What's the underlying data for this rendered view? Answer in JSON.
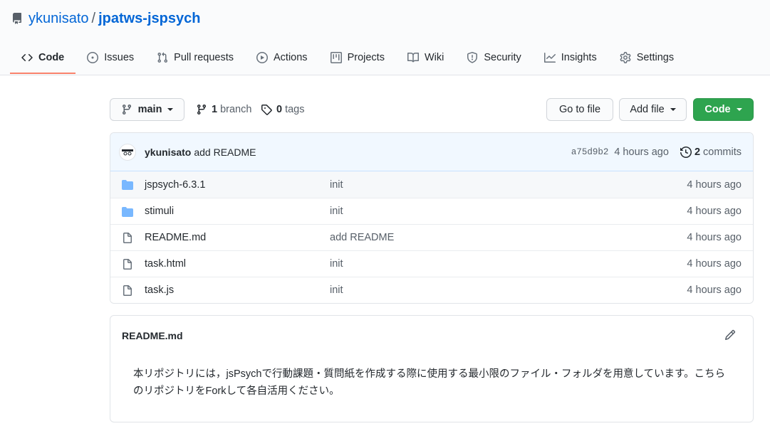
{
  "repo": {
    "owner": "ykunisato",
    "separator": "/",
    "name": "jpatws-jspsych"
  },
  "tabs": [
    {
      "label": "Code",
      "icon": "code-icon",
      "selected": true
    },
    {
      "label": "Issues",
      "icon": "issue-opened-icon"
    },
    {
      "label": "Pull requests",
      "icon": "git-pull-request-icon"
    },
    {
      "label": "Actions",
      "icon": "play-icon"
    },
    {
      "label": "Projects",
      "icon": "project-icon"
    },
    {
      "label": "Wiki",
      "icon": "book-icon"
    },
    {
      "label": "Security",
      "icon": "shield-icon"
    },
    {
      "label": "Insights",
      "icon": "graph-icon"
    },
    {
      "label": "Settings",
      "icon": "gear-icon"
    }
  ],
  "toolbar": {
    "branch_label": "main",
    "branches_count": "1",
    "branches_label": "branch",
    "tags_count": "0",
    "tags_label": "tags",
    "goto_label": "Go to file",
    "addfile_label": "Add file",
    "code_label": "Code"
  },
  "commit": {
    "author": "ykunisato",
    "message": "add README",
    "sha": "a75d9b2",
    "time": "4 hours ago",
    "commits_count": "2",
    "commits_label": "commits"
  },
  "files": [
    {
      "type": "dir",
      "name": "jspsych-6.3.1",
      "message": "init",
      "time": "4 hours ago"
    },
    {
      "type": "dir",
      "name": "stimuli",
      "message": "init",
      "time": "4 hours ago"
    },
    {
      "type": "file",
      "name": "README.md",
      "message": "add README",
      "time": "4 hours ago"
    },
    {
      "type": "file",
      "name": "task.html",
      "message": "init",
      "time": "4 hours ago"
    },
    {
      "type": "file",
      "name": "task.js",
      "message": "init",
      "time": "4 hours ago"
    }
  ],
  "readme": {
    "title": "README.md",
    "body": "本リポジトリには，jsPsychで行動課題・質問紙を作成する際に使用する最小限のファイル・フォルダを用意しています。こちらのリポジトリをForkして各自活用ください。"
  },
  "colors": {
    "link": "#0366d6",
    "tab_underline": "#f9826c",
    "code_button": "#2ea44f",
    "folder": "#79b8ff",
    "commit_bar": "#f1f8ff"
  }
}
